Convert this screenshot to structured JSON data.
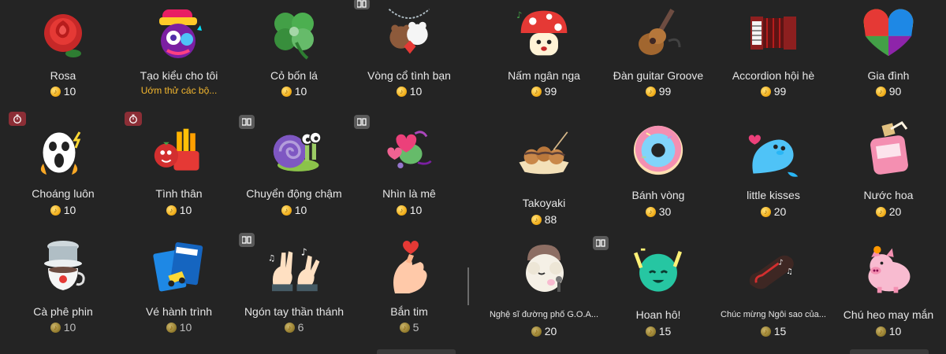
{
  "left_panel": {
    "gifts": [
      {
        "name": "Rosa",
        "price": "10",
        "icon": "rose-icon"
      },
      {
        "name": "Tạo kiểu cho tôi",
        "subtitle": "Uớm thử các bộ...",
        "icon": "style-me-character-icon"
      },
      {
        "name": "Cỏ bốn lá",
        "price": "10",
        "icon": "four-leaf-clover-icon"
      },
      {
        "name": "Vòng cổ tình bạn",
        "price": "10",
        "icon": "friendship-necklace-icon"
      },
      {
        "name": "Choáng luôn",
        "price": "10",
        "icon": "shocked-face-icon"
      },
      {
        "name": "Tình thân",
        "price": "10",
        "icon": "fries-and-tomato-icon"
      },
      {
        "name": "Chuyển động chậm",
        "price": "10",
        "icon": "snail-icon"
      },
      {
        "name": "Nhìn là mê",
        "price": "10",
        "icon": "heart-eyes-creature-icon"
      },
      {
        "name": "Cà phê phin",
        "price": "10",
        "icon": "phin-coffee-icon"
      },
      {
        "name": "Vé hành trình",
        "price": "10",
        "icon": "ticket-icon"
      },
      {
        "name": "Ngón tay thần thánh",
        "price": "6",
        "icon": "magic-fingers-icon"
      },
      {
        "name": "Bắn tim",
        "price": "5",
        "icon": "finger-heart-icon"
      }
    ]
  },
  "right_panel": {
    "gifts": [
      {
        "name": "Nấm ngân nga",
        "price": "99",
        "icon": "singing-mushroom-icon"
      },
      {
        "name": "Đàn guitar Groove",
        "price": "99",
        "icon": "guitar-icon"
      },
      {
        "name": "Accordion hội hè",
        "price": "99",
        "icon": "accordion-icon"
      },
      {
        "name": "Gia đình",
        "price": "90",
        "icon": "puzzle-heart-icon"
      },
      {
        "name": "Takoyaki",
        "price": "88",
        "icon": "takoyaki-icon"
      },
      {
        "name": "Bánh vòng",
        "price": "30",
        "icon": "donut-icon"
      },
      {
        "name": "little kisses",
        "price": "20",
        "icon": "seal-icon"
      },
      {
        "name": "Nước hoa",
        "price": "20",
        "icon": "perfume-icon"
      },
      {
        "name": "Nghệ sĩ đường phố G.O.A...",
        "price": "20",
        "icon": "street-artist-goat-icon"
      },
      {
        "name": "Hoan hô!",
        "price": "15",
        "icon": "cheering-ball-icon"
      },
      {
        "name": "Chúc mừng Ngôi sao của...",
        "price": "15",
        "icon": "guitar-case-icon"
      },
      {
        "name": "Chú heo may mắn",
        "price": "10",
        "icon": "lucky-pig-icon"
      }
    ]
  }
}
